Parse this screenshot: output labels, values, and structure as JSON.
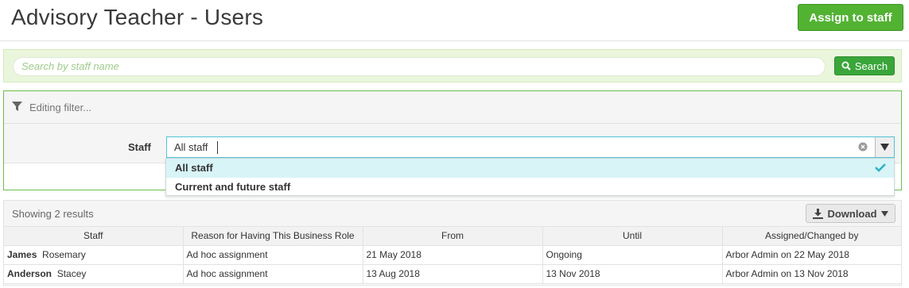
{
  "header": {
    "title": "Advisory Teacher - Users",
    "assign_label": "Assign to staff"
  },
  "search": {
    "placeholder": "Search by staff name",
    "button_label": "Search"
  },
  "filter": {
    "heading": "Editing filter...",
    "staff_label": "Staff",
    "staff_value": "All staff",
    "options": [
      {
        "label": "All staff",
        "selected": true
      },
      {
        "label": "Current and future staff",
        "selected": false
      }
    ]
  },
  "results": {
    "count_text": "Showing 2 results",
    "download_label": "Download"
  },
  "table": {
    "columns": [
      "Staff",
      "Reason for Having This Business Role",
      "From",
      "Until",
      "Assigned/Changed by"
    ],
    "rows": [
      {
        "surname": "James",
        "first": "Rosemary",
        "reason": "Ad hoc assignment",
        "from": "21 May 2018",
        "until": "Ongoing",
        "changed_by": "Arbor Admin on 22 May 2018"
      },
      {
        "surname": "Anderson",
        "first": "Stacey",
        "reason": "Ad hoc assignment",
        "from": "13 Aug 2018",
        "until": "13 Nov 2018",
        "changed_by": "Arbor Admin on 13 Nov 2018"
      }
    ]
  },
  "colors": {
    "accent_green": "#52b232",
    "search_bg": "#eaf6dc",
    "selected_option_bg": "#d8f4f7",
    "focus_border": "#4fc3d3"
  },
  "icons": [
    "filter-icon",
    "search-icon",
    "clear-icon",
    "chevron-down-icon",
    "check-icon",
    "download-icon"
  ]
}
